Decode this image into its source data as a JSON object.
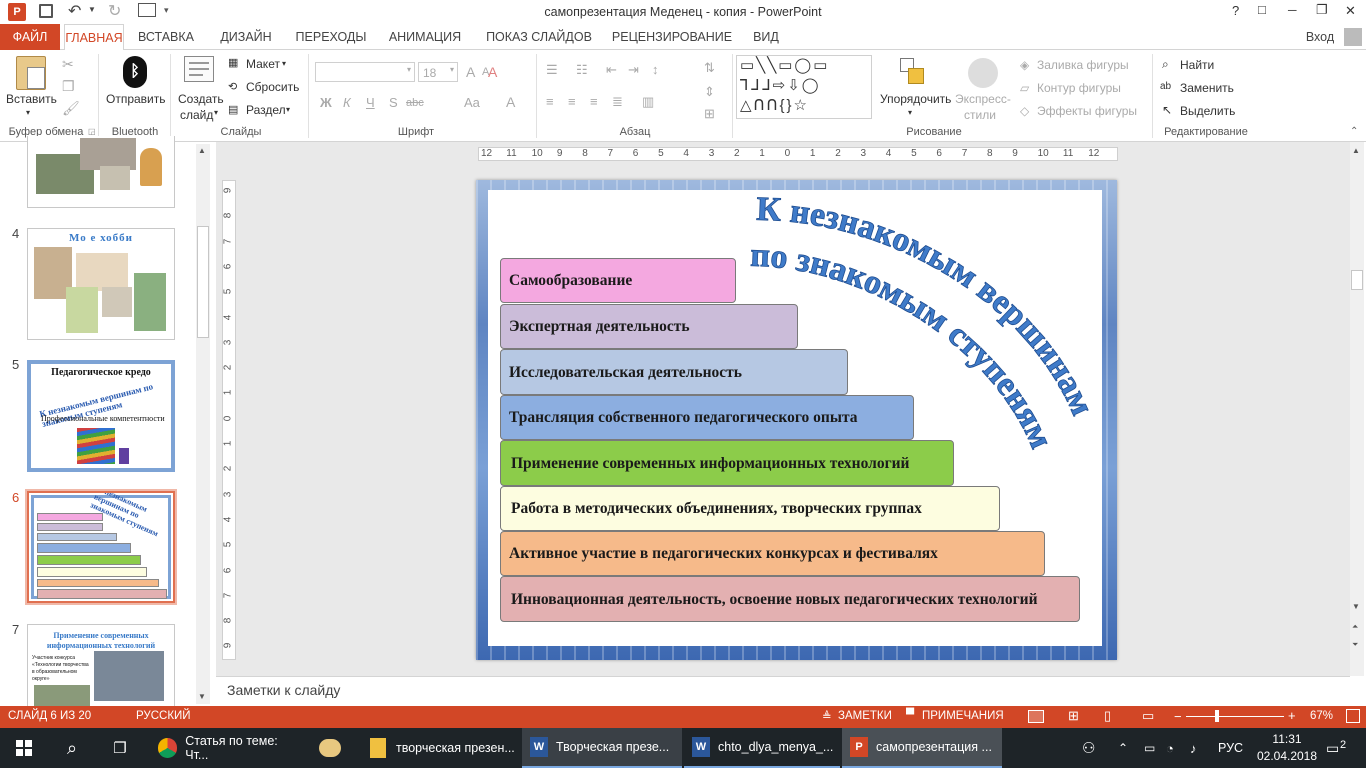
{
  "window": {
    "title": "самопрезентация Меденец - копия - PowerPoint",
    "help": "?",
    "btn_restore": "□",
    "btn_min": "─",
    "btn_max": "❐",
    "btn_close": "✕",
    "signin": "Вход"
  },
  "tabs": {
    "file": "ФАЙЛ",
    "home": "ГЛАВНАЯ",
    "insert": "ВСТАВКА",
    "design": "ДИЗАЙН",
    "transitions": "ПЕРЕХОДЫ",
    "animation": "АНИМАЦИЯ",
    "slideshow": "ПОКАЗ СЛАЙДОВ",
    "review": "РЕЦЕНЗИРОВАНИЕ",
    "view": "ВИД"
  },
  "ribbon": {
    "clipboard": {
      "paste": "Вставить",
      "label": "Буфер обмена"
    },
    "bluetooth": {
      "send": "Отправить",
      "label": "Bluetooth"
    },
    "slides": {
      "create": "Создать",
      "create2": "слайд",
      "layout": "Макет",
      "reset": "Сбросить",
      "section": "Раздел",
      "label": "Слайды"
    },
    "font": {
      "size": "18",
      "bold": "Ж",
      "italic": "К",
      "underline": "Ч",
      "strike": "S",
      "spacing": "abc",
      "case": "Aa",
      "grow": "A",
      "shrink": "A",
      "clear": "A",
      "color": "A",
      "label": "Шрифт"
    },
    "paragraph": {
      "label": "Абзац"
    },
    "drawing": {
      "arrange": "Упорядочить",
      "quick": "Экспресс-",
      "quick2": "стили",
      "fill": "Заливка фигуры",
      "outline": "Контур фигуры",
      "effects": "Эффекты фигуры",
      "label": "Рисование"
    },
    "editing": {
      "find": "Найти",
      "replace": "Заменить",
      "select": "Выделить",
      "label": "Редактирование"
    }
  },
  "ruler": {
    "ticks": [
      "12",
      "11",
      "10",
      "9",
      "8",
      "7",
      "6",
      "5",
      "4",
      "3",
      "2",
      "1",
      "0",
      "1",
      "2",
      "3",
      "4",
      "5",
      "6",
      "7",
      "8",
      "9",
      "10",
      "11",
      "12"
    ],
    "vticks": [
      "9",
      "8",
      "7",
      "6",
      "5",
      "4",
      "3",
      "2",
      "1",
      "0",
      "1",
      "2",
      "3",
      "4",
      "5",
      "6",
      "7",
      "8",
      "9"
    ]
  },
  "thumbnails": [
    {
      "num": "4",
      "title": "Мо е хобби"
    },
    {
      "num": "5",
      "title": "Педагогическое кредо",
      "arc": "К незнакомым вершинам по знакомым ступеням",
      "sub": "Профессиональные компетентности"
    },
    {
      "num": "6",
      "arc": "К незнакомым вершинам по знакомым ступеням"
    },
    {
      "num": "7",
      "title": "Применение современных информационных технологий",
      "caption": "Участник конкурса «Технологии творчества в образовательном округе»"
    }
  ],
  "slide": {
    "arc_line1": "К незнакомым вершинам",
    "arc_line2": "по знакомым ступеням",
    "steps": [
      {
        "text": "Самообразование",
        "color": "#f4a8e0"
      },
      {
        "text": "Экспертная деятельность",
        "color": "#cbbcd9"
      },
      {
        "text": "Исследовательская деятельность",
        "color": "#b6c8e3"
      },
      {
        "text": "Трансляция собственного педагогического опыта",
        "color": "#8caee0"
      },
      {
        "text": "Применение современных информационных технологий",
        "color": "#8ccc4a"
      },
      {
        "text": "Работа в методических объединениях, творческих группах",
        "color": "#fdfde0"
      },
      {
        "text": "Активное участие в педагогических конкурсах и фестивалях",
        "color": "#f6ba8a"
      },
      {
        "text": "Инновационная деятельность, освоение новых педагогических технологий",
        "color": "#e3b0b1"
      }
    ]
  },
  "notes": {
    "placeholder": "Заметки к слайду"
  },
  "status": {
    "slide": "СЛАЙД 6 ИЗ 20",
    "lang": "РУССКИЙ",
    "notes": "ЗАМЕТКИ",
    "comments": "ПРИМЕЧАНИЯ",
    "zoom": "67%"
  },
  "taskbar": {
    "items": [
      "Статья по теме: Чт...",
      "",
      "творческая презен...",
      "Творческая презе...",
      "chto_dlya_menya_...",
      "самопрезентация ..."
    ],
    "lang": "РУС",
    "time": "11:31",
    "date": "02.04.2018",
    "notif": "2"
  },
  "colors": {
    "accent": "#d24726",
    "taskbar": "#1e2428"
  }
}
